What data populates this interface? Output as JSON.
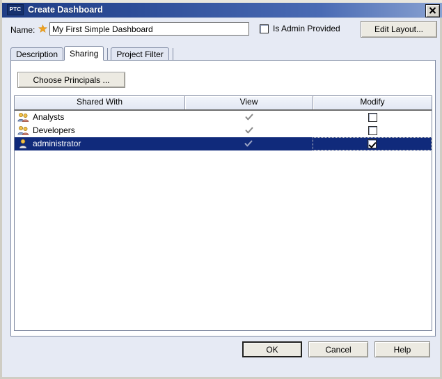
{
  "window": {
    "logo_text": "PTC",
    "title": "Create Dashboard",
    "close_icon": "close-icon"
  },
  "form": {
    "name_label": "Name:",
    "required_icon": "required-star-icon",
    "name_value": "My First Simple Dashboard",
    "name_placeholder": "",
    "is_admin_provided_label": "Is Admin Provided",
    "is_admin_provided_checked": false,
    "edit_layout_label": "Edit Layout..."
  },
  "tabs": [
    {
      "label": "Description",
      "active": false
    },
    {
      "label": "Sharing",
      "active": true
    },
    {
      "label": "Project Filter",
      "active": false
    }
  ],
  "sharing": {
    "choose_principals_label": "Choose Principals ...",
    "columns": [
      "Shared With",
      "View",
      "Modify"
    ],
    "rows": [
      {
        "name": "Analysts",
        "icon": "group-icon",
        "view": true,
        "modify": false,
        "selected": false
      },
      {
        "name": "Developers",
        "icon": "group-icon",
        "view": true,
        "modify": false,
        "selected": false
      },
      {
        "name": "administrator",
        "icon": "user-icon",
        "view": true,
        "modify": true,
        "selected": true
      }
    ]
  },
  "footer": {
    "ok_label": "OK",
    "cancel_label": "Cancel",
    "help_label": "Help"
  },
  "colors": {
    "titlebar_start": "#1f3d85",
    "titlebar_end": "#8aa3d2",
    "dialog_bg": "#e6eaf4",
    "selection": "#102a7b",
    "header_bg": "#e3e8f4",
    "required_star": "#f0a320"
  }
}
